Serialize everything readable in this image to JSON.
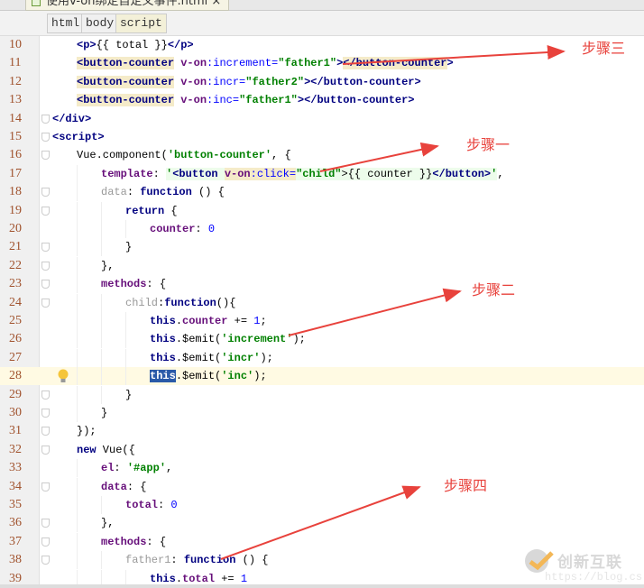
{
  "tab": {
    "title": "使用v-on绑定自定义事件.html ×"
  },
  "breadcrumbs": [
    "html",
    "body",
    "script"
  ],
  "current_line": 28,
  "code": [
    {
      "n": 10,
      "indent": 1,
      "fold": false,
      "t": [
        [
          "tag",
          "<p>"
        ],
        [
          "pl",
          "{{ total }}"
        ],
        [
          "tag",
          "</p>"
        ]
      ]
    },
    {
      "n": 11,
      "indent": 1,
      "fold": false,
      "t": [
        [
          "tag hl",
          "<button-counter"
        ],
        [
          "pl",
          " "
        ],
        [
          "von",
          "v-on"
        ],
        [
          "attr",
          ":increment="
        ],
        [
          "str",
          "\"father1\""
        ],
        [
          "tag",
          ">"
        ],
        [
          "tag hl",
          "</button-counter"
        ],
        [
          "tag",
          ">"
        ]
      ]
    },
    {
      "n": 12,
      "indent": 1,
      "fold": false,
      "t": [
        [
          "tag hl",
          "<button-counter"
        ],
        [
          "pl",
          " "
        ],
        [
          "von",
          "v-on"
        ],
        [
          "attr",
          ":incr="
        ],
        [
          "str",
          "\"father2\""
        ],
        [
          "tag",
          ">"
        ],
        [
          "tag",
          "</button-counter>"
        ]
      ]
    },
    {
      "n": 13,
      "indent": 1,
      "fold": false,
      "t": [
        [
          "tag hl",
          "<button-counter"
        ],
        [
          "pl",
          " "
        ],
        [
          "von",
          "v-on"
        ],
        [
          "attr",
          ":inc="
        ],
        [
          "str",
          "\"father1\""
        ],
        [
          "tag",
          ">"
        ],
        [
          "tag",
          "</button-counter>"
        ]
      ]
    },
    {
      "n": 14,
      "indent": 0,
      "fold": true,
      "t": [
        [
          "tag",
          "</div>"
        ]
      ]
    },
    {
      "n": 15,
      "indent": 0,
      "fold": true,
      "t": [
        [
          "tag",
          "<script>"
        ]
      ]
    },
    {
      "n": 16,
      "indent": 1,
      "fold": true,
      "t": [
        [
          "pl",
          "Vue.component("
        ],
        [
          "str",
          "'button-counter'"
        ],
        [
          "pl",
          ", {"
        ]
      ]
    },
    {
      "n": 17,
      "indent": 2,
      "fold": false,
      "t": [
        [
          "prop",
          "template"
        ],
        [
          "pl",
          ": "
        ],
        [
          "str hlg",
          "'"
        ],
        [
          "tag hlg",
          "<button "
        ],
        [
          "von hl",
          "v-on"
        ],
        [
          "attr hl",
          ":click="
        ],
        [
          "str hlg",
          "\"child\""
        ],
        [
          "pl hlg",
          ">{{ counter }}"
        ],
        [
          "tag hlg",
          "</button>"
        ],
        [
          "str hlg",
          "'"
        ],
        [
          "pl",
          ","
        ]
      ]
    },
    {
      "n": 18,
      "indent": 2,
      "fold": true,
      "t": [
        [
          "propn",
          "data"
        ],
        [
          "pl",
          ": "
        ],
        [
          "kw",
          "function"
        ],
        [
          "pl",
          " () {"
        ]
      ]
    },
    {
      "n": 19,
      "indent": 3,
      "fold": true,
      "t": [
        [
          "kw",
          "return"
        ],
        [
          "pl",
          " {"
        ]
      ]
    },
    {
      "n": 20,
      "indent": 4,
      "fold": false,
      "t": [
        [
          "prop",
          "counter"
        ],
        [
          "pl",
          ": "
        ],
        [
          "num",
          "0"
        ]
      ]
    },
    {
      "n": 21,
      "indent": 3,
      "fold": true,
      "t": [
        [
          "pl",
          "}"
        ]
      ]
    },
    {
      "n": 22,
      "indent": 2,
      "fold": true,
      "t": [
        [
          "pl",
          "},"
        ]
      ]
    },
    {
      "n": 23,
      "indent": 2,
      "fold": true,
      "t": [
        [
          "prop",
          "methods"
        ],
        [
          "pl",
          ": {"
        ]
      ]
    },
    {
      "n": 24,
      "indent": 3,
      "fold": true,
      "t": [
        [
          "propn",
          "child"
        ],
        [
          "pl",
          ":"
        ],
        [
          "kw",
          "function"
        ],
        [
          "pl",
          "(){"
        ]
      ]
    },
    {
      "n": 25,
      "indent": 4,
      "fold": false,
      "t": [
        [
          "kw",
          "this"
        ],
        [
          "pl",
          "."
        ],
        [
          "prop",
          "counter"
        ],
        [
          "pl",
          " += "
        ],
        [
          "num",
          "1"
        ],
        [
          "pl",
          ";"
        ]
      ]
    },
    {
      "n": 26,
      "indent": 4,
      "fold": false,
      "t": [
        [
          "kw",
          "this"
        ],
        [
          "pl",
          ".$emit("
        ],
        [
          "str",
          "'increment'"
        ],
        [
          "pl",
          ");"
        ]
      ]
    },
    {
      "n": 27,
      "indent": 4,
      "fold": false,
      "t": [
        [
          "kw",
          "this"
        ],
        [
          "pl",
          ".$emit("
        ],
        [
          "str",
          "'incr'"
        ],
        [
          "pl",
          ");"
        ]
      ]
    },
    {
      "n": 28,
      "indent": 4,
      "fold": false,
      "t": [
        [
          "kw sel",
          "this"
        ],
        [
          "pl",
          ".$emit("
        ],
        [
          "str",
          "'inc'"
        ],
        [
          "pl",
          ");"
        ]
      ]
    },
    {
      "n": 29,
      "indent": 3,
      "fold": true,
      "t": [
        [
          "pl",
          "}"
        ]
      ]
    },
    {
      "n": 30,
      "indent": 2,
      "fold": true,
      "t": [
        [
          "pl",
          "}"
        ]
      ]
    },
    {
      "n": 31,
      "indent": 1,
      "fold": true,
      "t": [
        [
          "pl",
          "});"
        ]
      ]
    },
    {
      "n": 32,
      "indent": 1,
      "fold": true,
      "t": [
        [
          "kw",
          "new"
        ],
        [
          "pl",
          " Vue({"
        ]
      ]
    },
    {
      "n": 33,
      "indent": 2,
      "fold": false,
      "t": [
        [
          "prop",
          "el"
        ],
        [
          "pl",
          ": "
        ],
        [
          "str",
          "'#app'"
        ],
        [
          "pl",
          ","
        ]
      ]
    },
    {
      "n": 34,
      "indent": 2,
      "fold": true,
      "t": [
        [
          "prop",
          "data"
        ],
        [
          "pl",
          ": {"
        ]
      ]
    },
    {
      "n": 35,
      "indent": 3,
      "fold": false,
      "t": [
        [
          "prop",
          "total"
        ],
        [
          "pl",
          ": "
        ],
        [
          "num",
          "0"
        ]
      ]
    },
    {
      "n": 36,
      "indent": 2,
      "fold": true,
      "t": [
        [
          "pl",
          "},"
        ]
      ]
    },
    {
      "n": 37,
      "indent": 2,
      "fold": true,
      "t": [
        [
          "prop",
          "methods"
        ],
        [
          "pl",
          ": {"
        ]
      ]
    },
    {
      "n": 38,
      "indent": 3,
      "fold": true,
      "t": [
        [
          "propn",
          "father1"
        ],
        [
          "pl",
          ": "
        ],
        [
          "kw",
          "function"
        ],
        [
          "pl",
          " () {"
        ]
      ]
    },
    {
      "n": 39,
      "indent": 4,
      "fold": false,
      "t": [
        [
          "kw",
          "this"
        ],
        [
          "pl",
          "."
        ],
        [
          "prop",
          "total"
        ],
        [
          "pl",
          " += "
        ],
        [
          "num",
          "1"
        ]
      ]
    }
  ],
  "annotations": [
    {
      "label": "步骤三",
      "color": "#e8423c"
    },
    {
      "label": "步骤一",
      "color": "#e8423c"
    },
    {
      "label": "步骤二",
      "color": "#e8423c"
    },
    {
      "label": "步骤四",
      "color": "#e8423c"
    }
  ],
  "watermark": {
    "text": "创新互联",
    "url": "https://blog.cs"
  }
}
